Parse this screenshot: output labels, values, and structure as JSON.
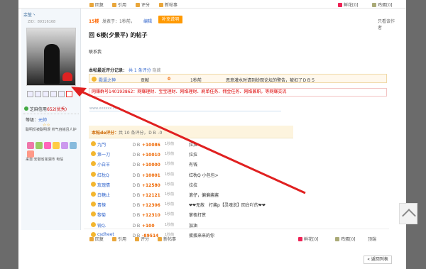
{
  "top_toolbar": {
    "reply": "回复",
    "quote": "引用",
    "rate": "评分",
    "new_thread": "新帖事",
    "flower": "鲜花[0]",
    "egg": "鸡蛋[0]"
  },
  "user": {
    "name": "余笙丶",
    "id": "ZID：89316168",
    "credit_label": "芝麻信用",
    "credit_value": "652(优秀)",
    "level_label": "等级：",
    "level_value": "元帅",
    "stars": "☆☆",
    "motto": "聪明反被聪明误 帅气自摇且人妒",
    "from": "来自:安徽省芜湖市 电信"
  },
  "post": {
    "floor": "15楼",
    "posted": "发表于：1秒前，",
    "edit": "编辑",
    "tag_button": "补充说明",
    "only_author": "只看该作者",
    "title": "回 6楼(夕景平) 的帖子",
    "body": "联系我",
    "rate_head_title": "本帖最近评分记录：",
    "rate_head_count": "共 1 条评分",
    "rate_head_hide": "隐藏",
    "rate_row": {
      "user": "殿逼之神",
      "type": "贡献",
      "value": "0",
      "time": "1秒前",
      "note": "恶意灌水时请到纷观论坛的警告，被扣了ＤＢ５"
    },
    "tip_group": "网赚群号140193862",
    "tip_text": "：网赚理财、宝宝理财、网络理财、刷单任务、佣金任务、网络兼职，等网赚交流",
    "url": "www.xxxxxx.com"
  },
  "rating_box": {
    "title": "本帖de评分：",
    "summary": "共 10 条评分，ＤＢ -0"
  },
  "ratings": [
    {
      "name": "九門",
      "unit": "ＤＢ",
      "delta": "+10086",
      "time": "1秒前",
      "note": "拉拉"
    },
    {
      "name": "第一刀",
      "unit": "ＤＢ",
      "delta": "+10010",
      "time": "1秒前",
      "note": "拉拉"
    },
    {
      "name": "小白羊",
      "unit": "ＤＢ",
      "delta": "+10000",
      "time": "1秒前",
      "note": "有钱"
    },
    {
      "name": "红枕Q",
      "unit": "ＤＢ",
      "delta": "+10001",
      "time": "1秒前",
      "note": "红枕Q 小包包>"
    },
    {
      "name": "玫瑰情",
      "unit": "ＤＢ",
      "delta": "+12580",
      "time": "1秒前",
      "note": "拉拉"
    },
    {
      "name": "白糖止",
      "unit": "ＤＢ",
      "delta": "+12121",
      "time": "1秒前",
      "note": "滚仔，偏偏酱酱"
    },
    {
      "name": "青楝",
      "unit": "ＤＢ",
      "delta": "+12306",
      "time": "1秒前",
      "note": "❤❤无赦　打酱p【灵魂说】回台吖的❤❤"
    },
    {
      "name": "黎菊",
      "unit": "ＤＢ",
      "delta": "+12310",
      "time": "1秒前",
      "note": "掌夜打赏"
    },
    {
      "name": "锐Q.",
      "unit": "ＤＢ",
      "delta": "+100",
      "time": "1秒前",
      "note": "加油"
    },
    {
      "name": "csdheet",
      "unit": "ＤＢ",
      "delta": "-89514",
      "time": "1秒前",
      "note": "蛋蛋来来的你"
    }
  ],
  "bottom_toolbar": {
    "reply": "回复",
    "quote": "引用",
    "rate": "评分",
    "new_thread": "新帖事",
    "flower": "鲜花[0]",
    "egg": "鸡蛋[0]",
    "top": "顶端"
  },
  "back_button": "« 返回列表",
  "colors": {
    "accent_blue": "#336699",
    "floor_orange": "#ff6600",
    "tip_red": "#dd0000",
    "rating_orange": "#ee6600",
    "arrow_red": "#e02020"
  }
}
